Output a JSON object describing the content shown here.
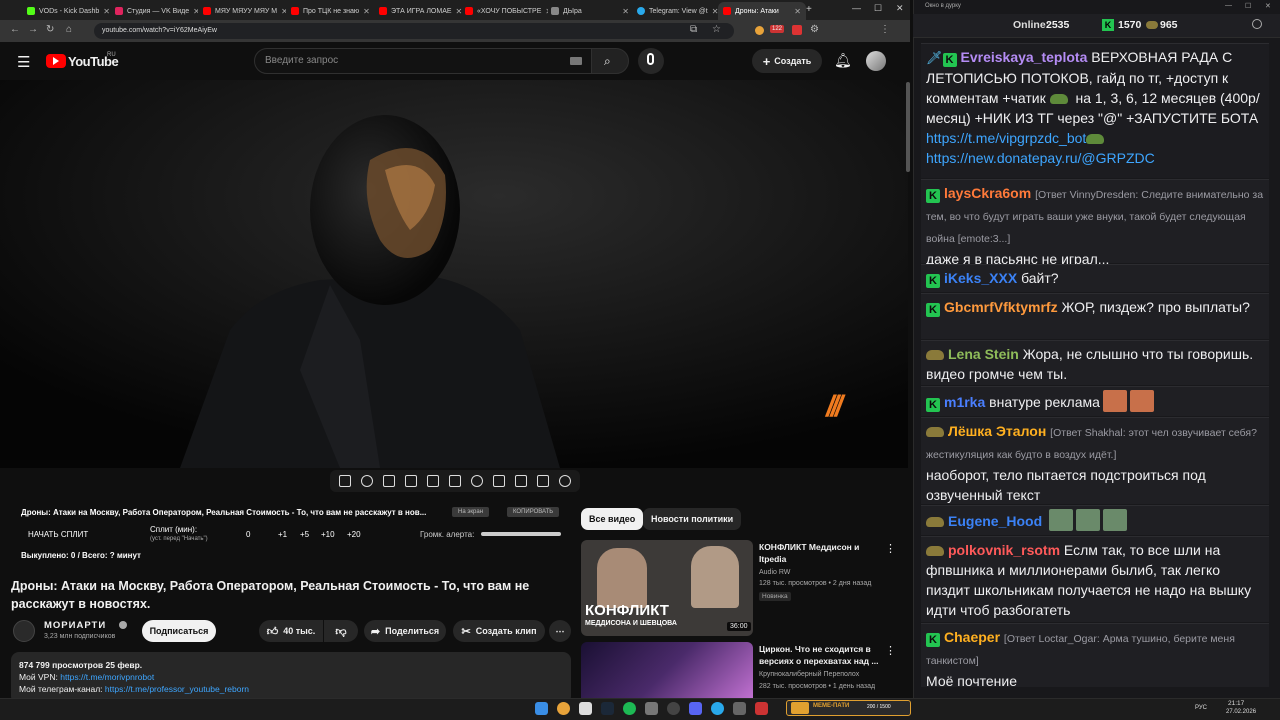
{
  "browser": {
    "tabs": [
      {
        "label": "VODs - Kick Dashb",
        "color": "#53fc18"
      },
      {
        "label": "Студия — VK Виде",
        "color": "#e0245e"
      },
      {
        "label": "МЯУ МЯУУ МЯУ М",
        "color": "#ff0000"
      },
      {
        "label": "Про ТЦК не знаю",
        "color": "#ff0000"
      },
      {
        "label": "ЭТА ИГРА ЛОМАЕ",
        "color": "#ff0000"
      },
      {
        "label": "«ХОЧУ ПОБЫСТРЕ",
        "color": "#ff0000"
      },
      {
        "label": "ДЫра",
        "color": "#888888"
      },
      {
        "label": "Telegram: View @t",
        "color": "#29a9eb"
      },
      {
        "label": "Дроны: Атаки",
        "color": "#ff0000"
      }
    ],
    "url": "youtube.com/watch?v=iY62MeAiyEw",
    "ext_badge": "122"
  },
  "youtube": {
    "logo": "YouTube",
    "region": "RU",
    "search_placeholder": "Введите запрос",
    "create_label": "Создать",
    "extension": {
      "video_short_title": "Дроны: Атаки на Москву, Работа Оператором, Реальная Стоимость - То, что вам не расскажут в нов...",
      "btn_inactive": "На экран",
      "btn_copy": "КОПИРОВАТЬ",
      "start_split": "НАЧАТЬ СПЛИТ",
      "split_label": "Сплит (мин):",
      "split_hint": "(уст. перед \"Начать\")",
      "split_value": "0",
      "increments": [
        "+1",
        "+5",
        "+10",
        "+20"
      ],
      "alert_volume_label": "Громк. алерта:",
      "done_label": "Выкуплено: 0 / Всего: ? минут"
    },
    "video": {
      "title": "Дроны: Атаки на Москву, Работа Оператором, Реальная Стоимость - То, что вам не расскажут в новостях.",
      "channel": "МОРИАРТИ",
      "subscribers": "3,23 млн подписчиков",
      "subscribe_label": "Подписаться",
      "likes": "40 тыс.",
      "share_label": "Поделиться",
      "clip_label": "Создать клип",
      "more_label": "⋯"
    },
    "description": {
      "views_date": "874 799 просмотров  25 февр.",
      "line2_prefix": "Мой VPN: ",
      "line2_link": "https://t.me/morivpnrobot",
      "line3_prefix": "Мой телеграм-канал: ",
      "line3_link": "https://t.me/professor_youtube_reborn"
    },
    "chips": [
      "Все видео",
      "Новости политики"
    ],
    "recs": [
      {
        "title": "КОНФЛИКТ Меддисон и Itpedia",
        "channel": "Audio RW",
        "meta": "128 тыс. просмотров • 2 дня назад",
        "badge": "Новинка",
        "duration": "36:00",
        "thumb_text1": "КОНФЛИКТ",
        "thumb_text2": "МЕДДИСОНА И ШЕВЦОВА"
      },
      {
        "title": "Циркон. Что не сходится в версиях о перехватах над ...",
        "channel": "Крупнокалиберный Переполох",
        "meta": "282 тыс. просмотров • 1 день назад"
      }
    ]
  },
  "taskbar": {
    "lang": "РУС",
    "time": "21:17",
    "date": "27.02.2026",
    "meme_label": "МЕМЕ-ПАТИ",
    "meme_progress": "200 / 1500"
  },
  "chat": {
    "window_title": "Окно в дурку",
    "online_label": "Online:",
    "online_count": "2535",
    "kick_count": "1570",
    "other_count": "965",
    "messages": [
      {
        "nick": "Evreiskaya_teplota",
        "nick_color": "#b58cf5",
        "text1": "ВЕРХОВНАЯ РАДА С ЛЕТОПИСЬЮ ПОТОКОВ, гайд по тг, +доступ к комментам +чатик",
        "text2": "на 1, 3, 6, 12 месяцев (400р/месяц) +НИК ИЗ ТГ через \"@\" +ЗАПУСТИТЕ БОТА",
        "link1": "https://t.me/vipgrpzdc_bot",
        "link2": "https://new.donatepay.ru/@GRPZDC"
      },
      {
        "nick": "laysCkra6om",
        "nick_color": "#ff7a3a",
        "reply": "[Ответ VinnyDresden: Следите внимательно за тем, во что будут играть ваши уже внуки, такой будет следующая война [emote:3...]",
        "text": "даже я в пасьянс не играл..."
      },
      {
        "nick": "iKeks_XXX",
        "nick_color": "#3b82f6",
        "text": "байт?"
      },
      {
        "nick": "GbcmrfVfktymrfz",
        "nick_color": "#ff9a3d",
        "text": "ЖОР, пиздеж? про выплаты?"
      },
      {
        "nick": "Lena Stein",
        "nick_color": "#8fbc5a",
        "text": "Жора, не слышно что ты говоришь. видео громче чем ты."
      },
      {
        "nick": "m1rka",
        "nick_color": "#4a7fff",
        "text": "внатуре реклама"
      },
      {
        "nick": "Лёшка Эталон",
        "nick_color": "#ffb020",
        "reply": "[Ответ Shakhal: этот чел озвучивает себя? жестикуляция как будто в воздух идёт.]",
        "text": "наоборот, тело пытается подстроиться под озвученный текст"
      },
      {
        "nick": "Eugene_Hood",
        "nick_color": "#3b82f6",
        "text": ""
      },
      {
        "nick": "polkovnik_rsotm",
        "nick_color": "#ff5a5a",
        "text": "Еслм так, то все шли на фпвшника и миллионерами былиб, так легко пиздит школьникам получается не надо на вышку идти чтоб разбогатеть"
      },
      {
        "nick": "Chaeper",
        "nick_color": "#ffb020",
        "reply": "[Ответ Loctar_Ogar: Арма тушино, берите меня танкистом]",
        "text": "Моё почтение"
      }
    ]
  }
}
